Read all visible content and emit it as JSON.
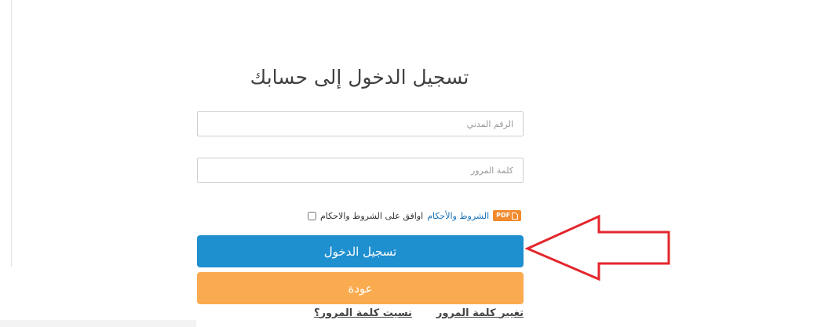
{
  "login": {
    "title": "تسجيل الدخول إلى حسابك",
    "civil_id_placeholder": "الرقم المدني",
    "password_placeholder": "كلمة المرور",
    "terms_prefix": "اوافق على الشروط والاحكام",
    "terms_link": "الشروط والأحكام",
    "pdf_badge": "PDF",
    "login_button": "تسجيل الدخول",
    "back_button": "عودة",
    "change_password_link": "تغيير كلمة المرور",
    "forgot_password_link": "نسيت كلمة المرور؟"
  },
  "colors": {
    "primary_button": "#1e8fcf",
    "secondary_button": "#fbab4f",
    "terms_link": "#1a73b8",
    "pdf_badge": "#f28a2e",
    "annotation_arrow": "#e3262c"
  }
}
